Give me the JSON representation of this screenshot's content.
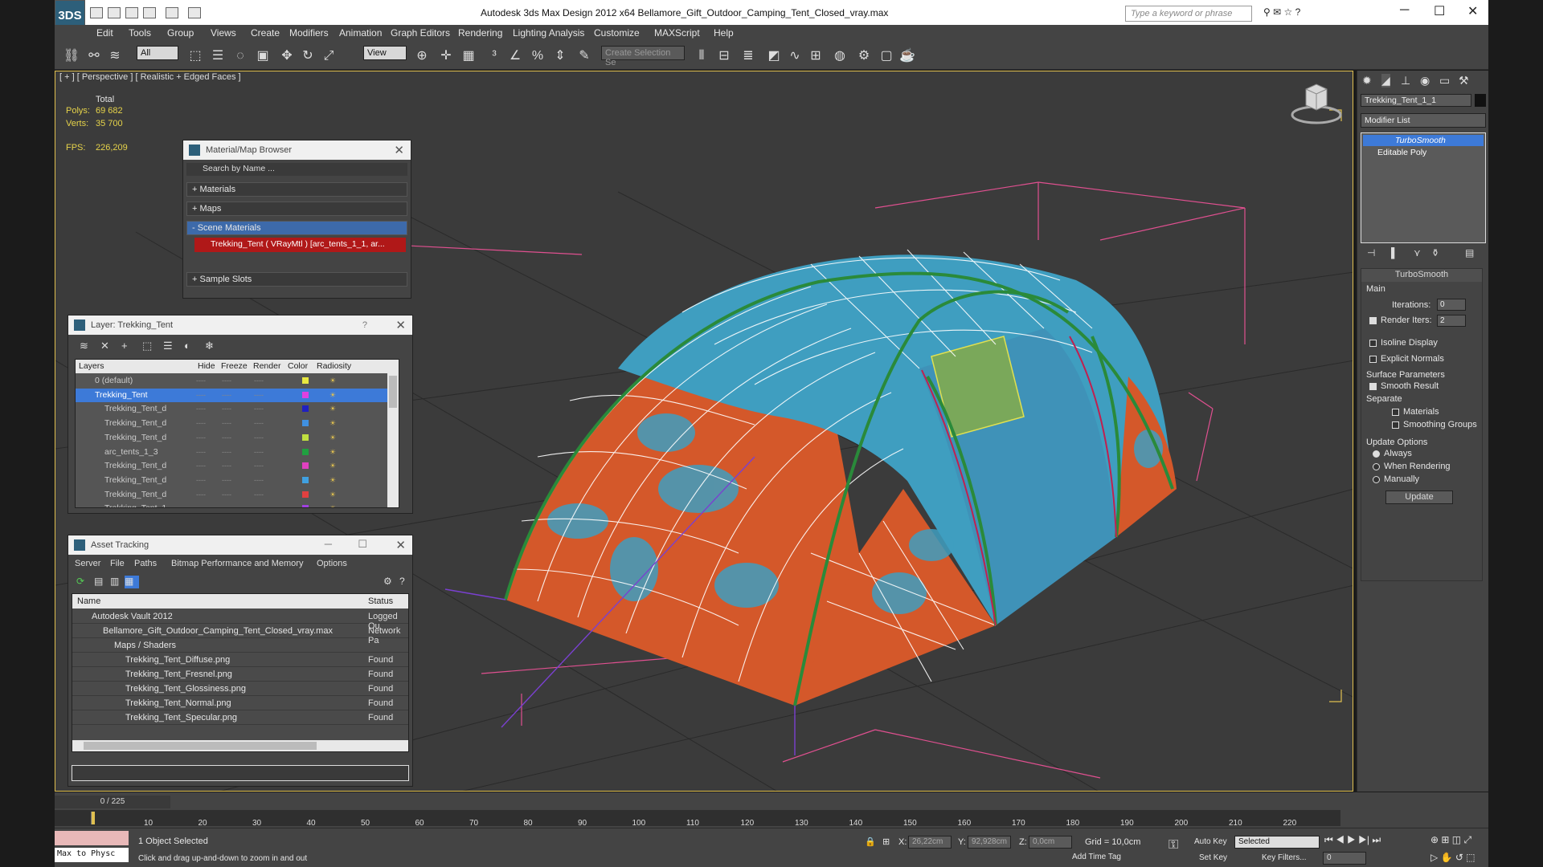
{
  "app": {
    "title": "Autodesk 3ds Max Design 2012 x64      Bellamore_Gift_Outdoor_Camping_Tent_Closed_vray.max",
    "logo": "3DS",
    "search_placeholder": "Type a keyword or phrase"
  },
  "menu": [
    "Edit",
    "Tools",
    "Group",
    "Views",
    "Create",
    "Modifiers",
    "Animation",
    "Graph Editors",
    "Rendering",
    "Lighting Analysis",
    "Customize",
    "MAXScript",
    "Help"
  ],
  "toolbar": {
    "selection_filter": "All",
    "ref_coord": "View",
    "selection_set": "Create Selection Se"
  },
  "viewport": {
    "label": "[ + ] [ Perspective ] [ Realistic + Edged Faces ]",
    "stats": {
      "total_label": "Total",
      "polys_label": "Polys:",
      "polys": "69 682",
      "verts_label": "Verts:",
      "verts": "35 700",
      "fps_label": "FPS:",
      "fps": "226,209"
    }
  },
  "material_browser": {
    "title": "Material/Map Browser",
    "search": "Search by Name ...",
    "materials": "+ Materials",
    "maps": "+ Maps",
    "scene_materials": "- Scene Materials",
    "scene_item": "Trekking_Tent  ( VRayMtl ) [arc_tents_1_1, ar...",
    "sample_slots": "+ Sample Slots"
  },
  "layer_dialog": {
    "title": "Layer: Trekking_Tent",
    "help": "?",
    "columns": [
      "Layers",
      "Hide",
      "Freeze",
      "Render",
      "Color",
      "Radiosity"
    ],
    "rows": [
      {
        "name": "0 (default)",
        "color": "#e8e840"
      },
      {
        "name": "Trekking_Tent",
        "color": "#e040e0",
        "selected": true
      },
      {
        "name": "Trekking_Tent_d",
        "color": "#2020c0"
      },
      {
        "name": "Trekking_Tent_d",
        "color": "#4090e0"
      },
      {
        "name": "Trekking_Tent_d",
        "color": "#c0e040"
      },
      {
        "name": "arc_tents_1_3",
        "color": "#20a040"
      },
      {
        "name": "Trekking_Tent_d",
        "color": "#e040c0"
      },
      {
        "name": "Trekking_Tent_d",
        "color": "#40a0e0"
      },
      {
        "name": "Trekking_Tent_d",
        "color": "#e04040"
      },
      {
        "name": "Trekking_Tent_1",
        "color": "#a040e0"
      }
    ]
  },
  "asset_tracking": {
    "title": "Asset Tracking",
    "menu": [
      "Server",
      "File",
      "Paths",
      "Bitmap Performance and Memory",
      "Options"
    ],
    "col_name": "Name",
    "col_status": "Status",
    "rows": [
      {
        "name": "Autodesk Vault 2012",
        "status": "Logged Ou",
        "indent": 1
      },
      {
        "name": "Bellamore_Gift_Outdoor_Camping_Tent_Closed_vray.max",
        "status": "Network Pa",
        "indent": 2
      },
      {
        "name": "Maps / Shaders",
        "status": "",
        "indent": 3
      },
      {
        "name": "Trekking_Tent_Diffuse.png",
        "status": "Found",
        "indent": 4
      },
      {
        "name": "Trekking_Tent_Fresnel.png",
        "status": "Found",
        "indent": 4
      },
      {
        "name": "Trekking_Tent_Glossiness.png",
        "status": "Found",
        "indent": 4
      },
      {
        "name": "Trekking_Tent_Normal.png",
        "status": "Found",
        "indent": 4
      },
      {
        "name": "Trekking_Tent_Specular.png",
        "status": "Found",
        "indent": 4
      }
    ]
  },
  "command_panel": {
    "object_name": "Trekking_Tent_1_1",
    "modifier_list": "Modifier List",
    "stack": [
      "TurboSmooth",
      "Editable Poly"
    ],
    "rollout_title": "TurboSmooth",
    "main": "Main",
    "iterations_label": "Iterations:",
    "iterations": "0",
    "render_iters_label": "Render Iters:",
    "render_iters": "2",
    "isoline": "Isoline Display",
    "explicit_normals": "Explicit Normals",
    "surface_params": "Surface Parameters",
    "smooth_result": "Smooth Result",
    "separate": "Separate",
    "materials": "Materials",
    "smoothing_groups": "Smoothing Groups",
    "update_options": "Update Options",
    "always": "Always",
    "when_rendering": "When Rendering",
    "manually": "Manually",
    "update_button": "Update"
  },
  "timeline": {
    "frame": "0 / 225",
    "ticks": [
      "10",
      "20",
      "30",
      "40",
      "50",
      "60",
      "70",
      "80",
      "90",
      "100",
      "110",
      "120",
      "130",
      "140",
      "150",
      "160",
      "170",
      "180",
      "190",
      "200",
      "210",
      "220"
    ]
  },
  "status": {
    "script_listener": "Max to Physc",
    "selected": "1 Object Selected",
    "prompt": "Click and drag up-and-down to zoom in and out",
    "x_label": "X:",
    "x": "26,22cm",
    "y_label": "Y:",
    "y": "92,928cm",
    "z_label": "Z:",
    "z": "0,0cm",
    "grid": "Grid = 10,0cm",
    "auto_key": "Auto Key",
    "set_key": "Set Key",
    "key_mode": "Selected",
    "key_filters": "Key Filters...",
    "add_time_tag": "Add Time Tag",
    "frame_field": "0"
  },
  "colors": {
    "tent_orange": "#d4582a",
    "tent_blue": "#3f9ec0",
    "viewport_bg": "#3b3b3b",
    "accent_select": "#3d7ad8"
  }
}
